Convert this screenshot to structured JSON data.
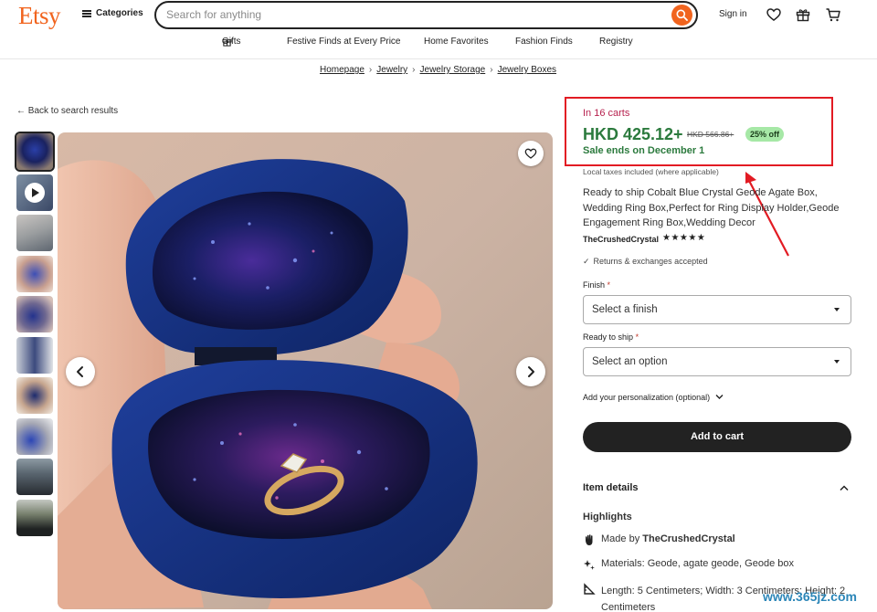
{
  "header": {
    "logo": "Etsy",
    "categories_label": "Categories",
    "search_placeholder": "Search for anything",
    "signin_label": "Sign in"
  },
  "subnav": [
    {
      "label": "Gifts",
      "icon": "gift-icon"
    },
    {
      "label": "Festive Finds at Every Price"
    },
    {
      "label": "Home Favorites"
    },
    {
      "label": "Fashion Finds"
    },
    {
      "label": "Registry"
    }
  ],
  "breadcrumb": [
    "Homepage",
    "Jewelry",
    "Jewelry Storage",
    "Jewelry Boxes"
  ],
  "back_link": "Back to search results",
  "product": {
    "in_carts": "In 16 carts",
    "price": "HKD 425.12+",
    "original_price": "HKD 566.86+",
    "discount": "25% off",
    "sale_ends": "Sale ends on December 1",
    "taxes_note": "Local taxes included (where applicable)",
    "title": "Ready to ship Cobalt Blue Crystal Geode Agate Box, Wedding Ring Box,Perfect for Ring Display Holder,Geode Engagement Ring Box,Wedding Decor",
    "shop_name": "TheCrushedCrystal",
    "stars": "★★★★★",
    "returns": "Returns & exchanges accepted",
    "finish_label": "Finish",
    "finish_value": "Select a finish",
    "ready_label": "Ready to ship",
    "ready_value": "Select an option",
    "required_mark": "*",
    "personalization": "Add your personalization (optional)",
    "add_to_cart": "Add to cart",
    "item_details": "Item details",
    "highlights": "Highlights",
    "made_by_prefix": "Made by",
    "made_by_shop": "TheCrushedCrystal",
    "materials": "Materials: Geode, agate geode, Geode box",
    "dimensions": "Length: 5 Centimeters; Width: 3 Centimeters; Height: 2 Centimeters"
  },
  "watermark": "www.365jz.com",
  "colors": {
    "brand": "#F1641E",
    "price_green": "#2b7a3d",
    "carts_red": "#b7224f",
    "highlight_box": "#e21b23",
    "discount_bg": "#a6e8a6"
  }
}
